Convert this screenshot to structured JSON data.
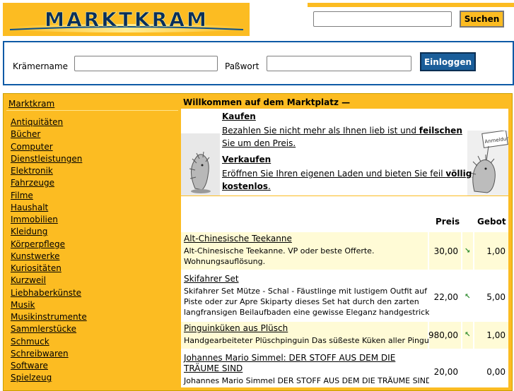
{
  "header": {
    "logo_text": "MARKTKRAM",
    "search": {
      "placeholder": "",
      "value": "",
      "button_label": "Suchen"
    }
  },
  "login": {
    "user_label": "Krämername",
    "pass_label": "Paßwort",
    "button_label": "Einloggen"
  },
  "sidebar": {
    "title": "Marktkram",
    "items": [
      "Antiquitäten",
      "Bücher",
      "Computer",
      "Dienstleistungen",
      "Elektronik",
      "Fahrzeuge",
      "Filme",
      "Haushalt",
      "Immobilien",
      "Kleidung",
      "Körperpflege",
      "Kunstwerke",
      "Kuriositäten",
      "Kurzweil",
      "Liebhaberkünste",
      "Musik",
      "Musikinstrumente",
      "Sammlerstücke",
      "Schmuck",
      "Schreibwaren",
      "Software",
      "Spielzeug"
    ]
  },
  "content": {
    "welcome_title": "Willkommen auf dem Marktplatz —",
    "buy": {
      "heading": "Kaufen",
      "line1_a": "Bezahlen Sie nicht mehr als Ihnen lieb ist und ",
      "line1_b": "feilschen",
      "line2": "Sie um den Preis."
    },
    "sell": {
      "heading": "Verkaufen",
      "line1_a": "Eröffnen Sie Ihren eigenen Laden und bieten Sie feil ",
      "line1_b": "völlig",
      "line2_b": "kostenlos",
      "line2_c": "."
    },
    "right_sign": "Anmeldung",
    "columns": {
      "price": "Preis",
      "bid": "Gebot"
    },
    "listings": [
      {
        "title": "Alt-Chinesische Teekanne",
        "desc": [
          "Alt-Chinesische Teekanne. VP oder beste Offerte.",
          "Wohnungsauflösung."
        ],
        "price": "30,00",
        "trend": "down",
        "bid": "1,00"
      },
      {
        "title": "Skifahrer Set",
        "desc": [
          "Skifahrer Set Mütze - Schal - Fäustlinge mit lustigem Outfit auf die",
          "Piste oder zur Apre Skiparty dieses Set hat durch den zarten",
          "langfransigen Beilaufbaden eine gewisse Eleganz handgestrickt  Fä"
        ],
        "price": "22,00",
        "trend": "up",
        "bid": "5,00"
      },
      {
        "title": "Pinguinküken aus Plüsch",
        "desc": [
          "Handgearbeiteter Plüschpinguin Das süßeste Küken aller Pinguine"
        ],
        "price": "980,00",
        "trend": "up",
        "bid": "1,00"
      },
      {
        "title_lines": [
          "Johannes Mario Simmel: DER STOFF AUS DEM DIE",
          "TRÄUME SIND"
        ],
        "desc": [
          "Johannes Mario Simmel DER STOFF AUS DEM DIE TRÄUME SIND"
        ],
        "price": "20,00",
        "trend": "",
        "bid": "0,00"
      }
    ]
  }
}
